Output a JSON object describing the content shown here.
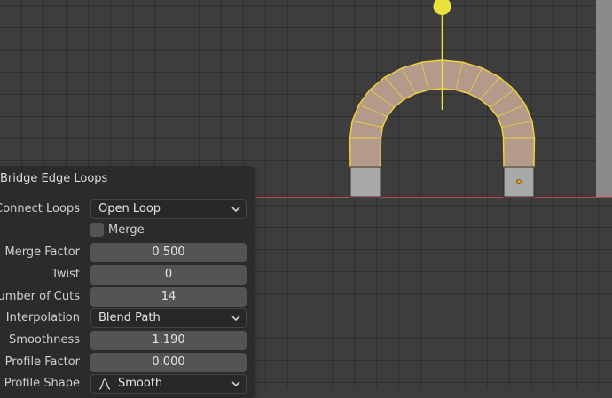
{
  "panel": {
    "title": "Bridge Edge Loops",
    "connect_loops": {
      "label": "Connect Loops",
      "value": "Open Loop"
    },
    "merge": {
      "label": "Merge",
      "checked": false
    },
    "merge_factor": {
      "label": "Merge Factor",
      "value": "0.500"
    },
    "twist": {
      "label": "Twist",
      "value": "0"
    },
    "number_of_cuts": {
      "label": "Number of Cuts",
      "value": "14"
    },
    "interpolation": {
      "label": "Interpolation",
      "value": "Blend Path"
    },
    "smoothness": {
      "label": "Smoothness",
      "value": "1.190"
    },
    "profile_factor": {
      "label": "Profile Factor",
      "value": "0.000"
    },
    "profile_shape": {
      "label": "Profile Shape",
      "value": "Smooth",
      "icon": "smooth-falloff-icon"
    }
  },
  "viewport": {
    "colors": {
      "background": "#3d3d3d",
      "face": "#b49a8a",
      "selected_edge": "#f5d538",
      "unselected_face": "#a9a9a9",
      "x_axis": "#b5474e"
    }
  }
}
